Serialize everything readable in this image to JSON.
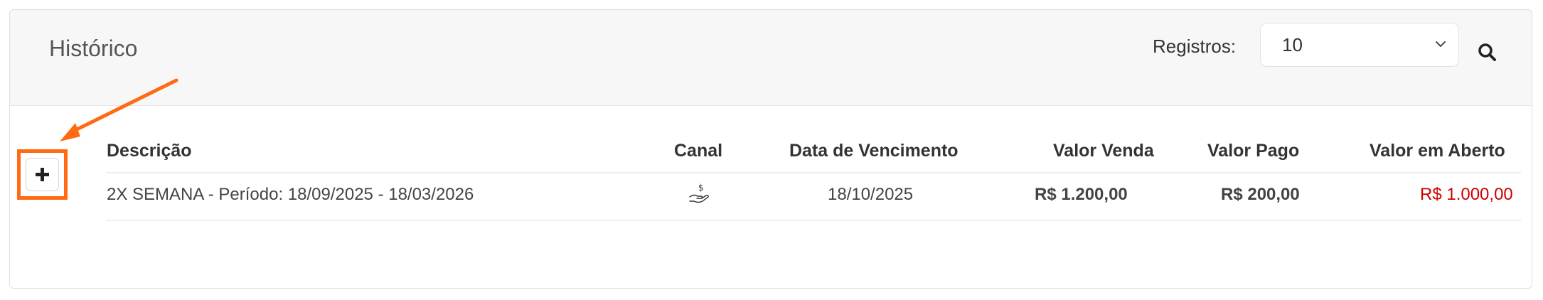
{
  "header": {
    "title": "Histórico",
    "registros_label": "Registros:",
    "registros_value": "10",
    "search_icon": "search-icon"
  },
  "table": {
    "columns": {
      "descricao": "Descrição",
      "canal": "Canal",
      "data_vencimento": "Data de Vencimento",
      "valor_venda": "Valor Venda",
      "valor_pago": "Valor Pago",
      "valor_aberto": "Valor em Aberto"
    },
    "rows": [
      {
        "descricao": "2X SEMANA - Período: 18/09/2025 - 18/03/2026",
        "canal_icon": "hand-money-icon",
        "data_vencimento": "18/10/2025",
        "valor_venda": "R$ 1.200,00",
        "valor_pago": "R$ 200,00",
        "valor_aberto": "R$ 1.000,00"
      }
    ]
  },
  "annotation": {
    "highlight_color": "#ff6a13"
  },
  "colors": {
    "open_value": "#d00000",
    "header_bg": "#f7f7f7"
  }
}
